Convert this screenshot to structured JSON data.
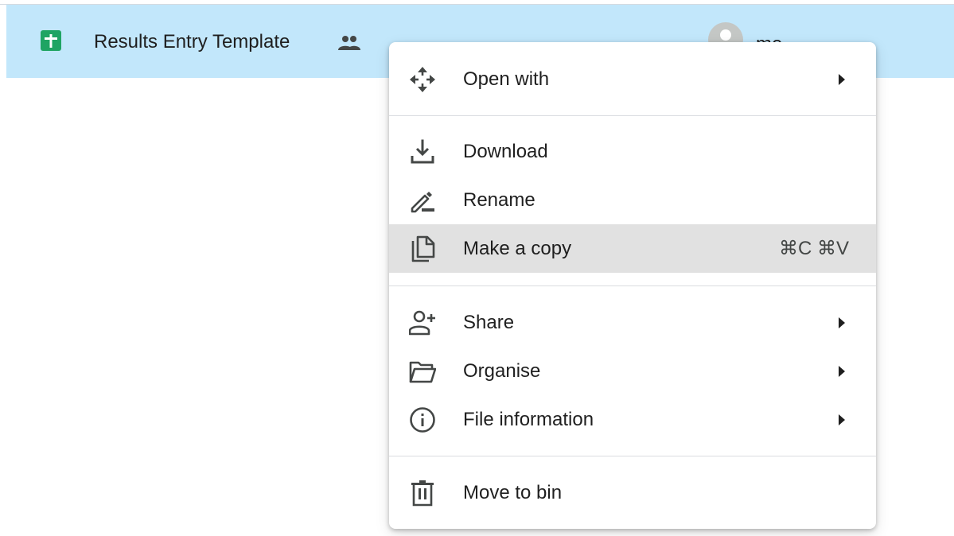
{
  "file_row": {
    "name": "Results Entry Template",
    "owner": "me",
    "highlight_color": "#c2e7fb",
    "file_icon": "google-sheets-icon",
    "shared_icon": "shared-people-icon",
    "sheets_color": "#1fa463"
  },
  "context_menu": {
    "open_with": {
      "label": "Open with",
      "icon": "move-arrows-icon",
      "has_submenu": true
    },
    "download": {
      "label": "Download",
      "icon": "download-icon"
    },
    "rename": {
      "label": "Rename",
      "icon": "pencil-icon"
    },
    "make_copy": {
      "label": "Make a copy",
      "icon": "copy-icon",
      "shortcut": "⌘C ⌘V",
      "highlighted": true
    },
    "share": {
      "label": "Share",
      "icon": "person-add-icon",
      "has_submenu": true
    },
    "organise": {
      "label": "Organise",
      "icon": "folder-open-icon",
      "has_submenu": true
    },
    "file_information": {
      "label": "File information",
      "icon": "info-icon",
      "has_submenu": true
    },
    "move_to_bin": {
      "label": "Move to bin",
      "icon": "trash-icon"
    },
    "highlight_color": "#e1e1e1"
  }
}
